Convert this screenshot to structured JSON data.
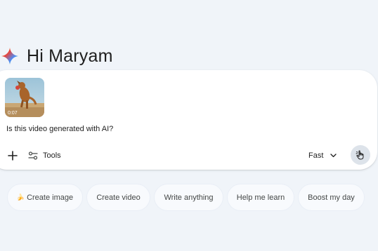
{
  "greeting": {
    "text": "Hi Maryam",
    "icon": "gemini-spark-icon"
  },
  "composer": {
    "attachment": {
      "type": "video",
      "duration": "0:07",
      "icon": "video-thumbnail"
    },
    "prompt_text": "Is this video generated with AI?",
    "tools_label": "Tools",
    "mode_label": "Fast",
    "icons": {
      "add": "plus-icon",
      "tools": "sliders-icon",
      "mode_dropdown": "chevron-down-icon",
      "send": "pointer-icon"
    }
  },
  "suggestions": [
    {
      "label": "Create image",
      "icon": "banana-icon"
    },
    {
      "label": "Create video"
    },
    {
      "label": "Write anything"
    },
    {
      "label": "Help me learn"
    },
    {
      "label": "Boost my day"
    }
  ],
  "colors": {
    "background": "#f0f4f9",
    "composer_bg": "#ffffff",
    "chip_bg": "#f8fafd",
    "send_bg": "#dde3ea",
    "text": "#1f1f1f"
  }
}
